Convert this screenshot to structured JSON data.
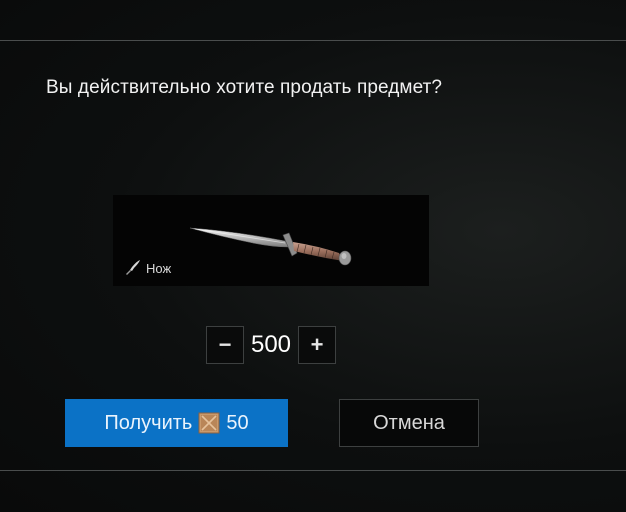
{
  "dialog": {
    "question": "Вы действительно хотите продать предмет?"
  },
  "item": {
    "name": "Нож",
    "type_icon": "knife-icon"
  },
  "quantity": {
    "decrement_label": "−",
    "value": "500",
    "increment_label": "+"
  },
  "actions": {
    "confirm_label": "Получить",
    "confirm_amount": "50",
    "currency_icon": "currency-icon",
    "cancel_label": "Отмена"
  },
  "colors": {
    "primary": "#0b72c6",
    "background": "#0b0c0c",
    "border": "#3d4040",
    "currency": "#c99a6c"
  }
}
